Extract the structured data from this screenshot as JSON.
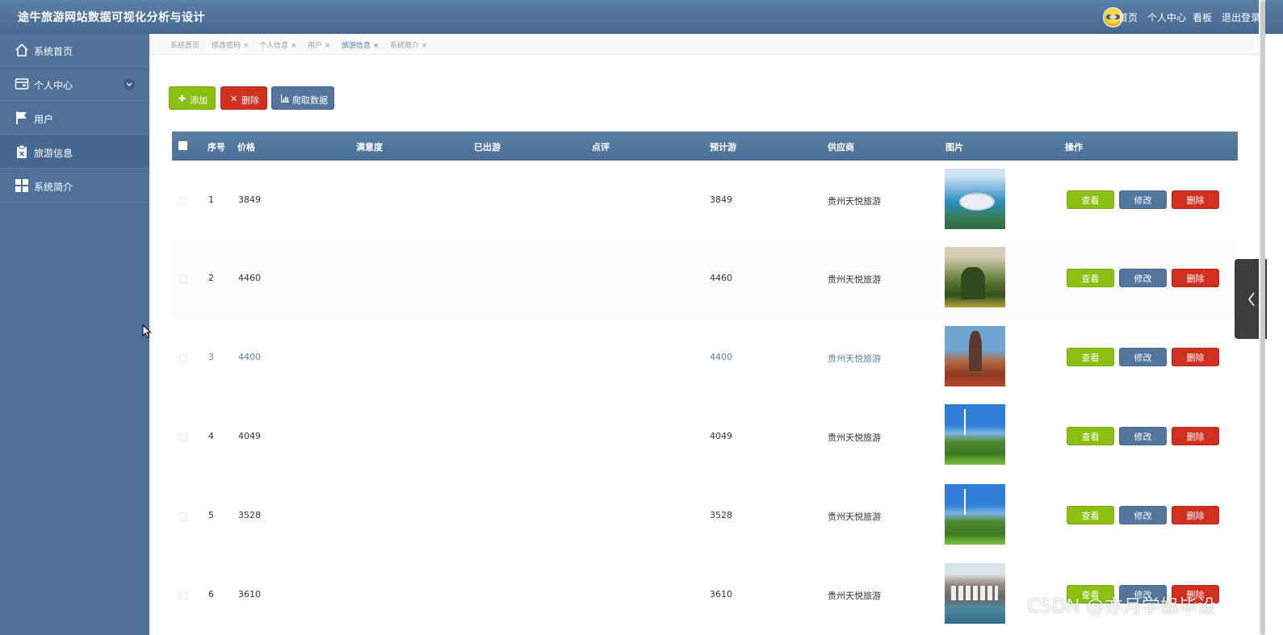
{
  "app": {
    "title": "途牛旅游网站数据可视化分析与设计"
  },
  "topnav": {
    "home": "首页",
    "profile": "个人中心",
    "board": "看板",
    "logout": "退出登录"
  },
  "sidebar": {
    "items": [
      {
        "label": "系统首页",
        "icon": "home-icon"
      },
      {
        "label": "个人中心",
        "icon": "wallet-icon"
      },
      {
        "label": "用户",
        "icon": "flag-icon"
      },
      {
        "label": "旅游信息",
        "icon": "clipboard-icon"
      },
      {
        "label": "系统简介",
        "icon": "grid-icon"
      }
    ],
    "active_index": 3
  },
  "tabs": [
    {
      "label": "系统首页"
    },
    {
      "label": "修改密码 ×"
    },
    {
      "label": "个人信息 ×"
    },
    {
      "label": "用户 ×"
    },
    {
      "label": "旅游信息 ×"
    },
    {
      "label": "系统简介 ×"
    }
  ],
  "toolbar": {
    "add_label": "添加",
    "delete_label": "删除",
    "crawl_label": "爬取数据"
  },
  "table": {
    "headers": [
      "序号",
      "价格",
      "满意度",
      "已出游",
      "点评",
      "预计游",
      "供应商",
      "图片",
      "操作"
    ],
    "rows": [
      {
        "index": "1",
        "price": "3849",
        "satisfaction": "",
        "traveled": "",
        "reviews": "",
        "expected": "3849",
        "supplier": "贵州天悦旅游"
      },
      {
        "index": "2",
        "price": "4460",
        "satisfaction": "",
        "traveled": "",
        "reviews": "",
        "expected": "4460",
        "supplier": "贵州天悦旅游"
      },
      {
        "index": "3",
        "price": "4400",
        "satisfaction": "",
        "traveled": "",
        "reviews": "",
        "expected": "4400",
        "supplier": "贵州天悦旅游"
      },
      {
        "index": "4",
        "price": "4049",
        "satisfaction": "",
        "traveled": "",
        "reviews": "",
        "expected": "4049",
        "supplier": "贵州天悦旅游"
      },
      {
        "index": "5",
        "price": "3528",
        "satisfaction": "",
        "traveled": "",
        "reviews": "",
        "expected": "3528",
        "supplier": "贵州天悦旅游"
      },
      {
        "index": "6",
        "price": "3610",
        "satisfaction": "",
        "traveled": "",
        "reviews": "",
        "expected": "3610",
        "supplier": "贵州天悦旅游"
      }
    ],
    "actions": {
      "view": "查看",
      "edit": "修改",
      "delete": "删除"
    }
  },
  "watermark": "CSDN @亦月学姐毕设",
  "colors": {
    "header": "#4e7098",
    "add": "#8bbf12",
    "delete": "#d12f1f",
    "primary": "#53769d"
  }
}
